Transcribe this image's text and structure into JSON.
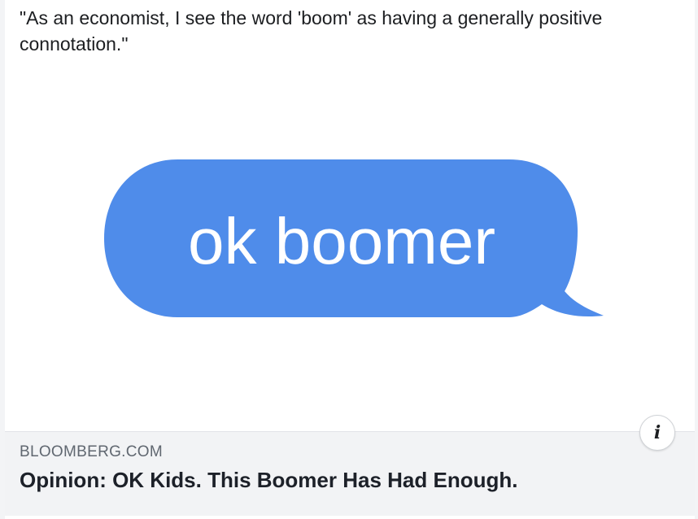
{
  "post": {
    "text": "\"As an economist, I see the word 'boom' as having a generally positive connotation.\""
  },
  "link_preview": {
    "image": {
      "bubble_text": "ok boomer",
      "bubble_color": "#4f8cea"
    },
    "domain": "BLOOMBERG.COM",
    "title": "Opinion: OK Kids. This Boomer Has Had Enough.",
    "info_button_glyph": "i",
    "info_icon": "info-icon"
  }
}
